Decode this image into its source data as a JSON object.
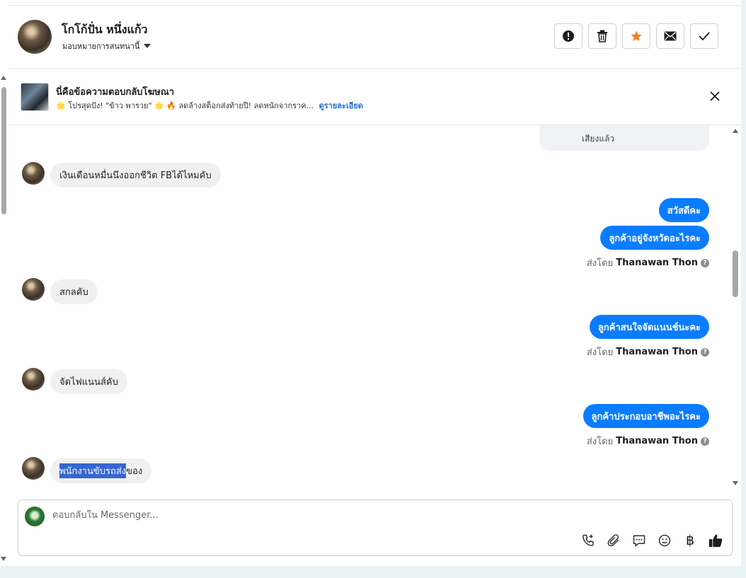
{
  "header": {
    "contact_name": "โกโก้ปั่น หนึ่งแก้ว",
    "assign_label": "มอบหมายการสนทนานี้",
    "actions": [
      "spam-icon",
      "trash-icon",
      "star-icon",
      "envelope-icon",
      "check-icon"
    ],
    "star_color": "#f58220"
  },
  "ad_banner": {
    "title": "นี่คือข้อความตอบกลับโฆษณา",
    "description": "🌟 โปรสุดปัง! \"ข้าว พารวย\" 🌟 🔥 ลดล้างสต็อกส่งท้ายปี! ลดหนักจากราค...",
    "details_link": "ดูรายละเอียด"
  },
  "previous_bubble_text": "เสียงแล้ว",
  "messages": {
    "m1": "เงินเดือนหมื่นนึงออกชีวิต FBได้ไหมคับ",
    "m2": "สวัสดีคะ",
    "m3": "ลูกค้าอยู่จังหวัดอะไรคะ",
    "m4": "สกลคับ",
    "m5": "ลูกค้าสนใจจัดแนนช์นะคะ",
    "m6": "จัดไฟแนนส์คับ",
    "m7": "ลูกค้าประกอบอาชีพอะไรคะ",
    "m8_selected": "พนักงานขับรถส่ง",
    "m8_rest": "ของ"
  },
  "sent_by": {
    "prefix": "ส่งโดย",
    "name": "Thanawan Thon",
    "help": "?"
  },
  "composer": {
    "placeholder": "ตอบกลับใน Messenger...",
    "tools": [
      "phone-plus-icon",
      "paperclip-icon",
      "chat-bubble-icon",
      "emoji-icon",
      "baht-icon",
      "thumbs-up-icon"
    ],
    "baht_symbol": "฿"
  },
  "colors": {
    "outgoing_bubble": "#0a7cff",
    "incoming_bubble": "#f0f0f0",
    "link": "#1a6fd6",
    "selection": "#3566cf"
  }
}
